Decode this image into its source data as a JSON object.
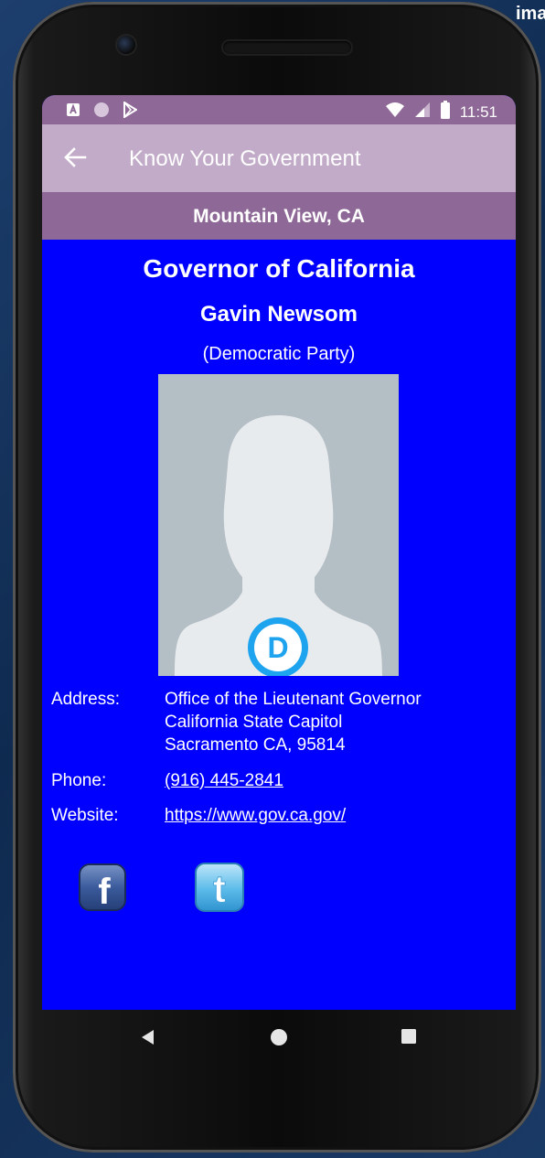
{
  "background_corner_text": "ima",
  "status_bar": {
    "time": "11:51",
    "left_icons": [
      "a-notification-icon",
      "circle-notification-icon",
      "play-store-icon"
    ],
    "right_icons": [
      "wifi-icon",
      "signal-icon",
      "battery-icon"
    ]
  },
  "app_bar": {
    "back_icon": "arrow-back-icon",
    "title": "Know Your Government"
  },
  "location": "Mountain View, CA",
  "official": {
    "office": "Governor of California",
    "name": "Gavin Newsom",
    "party": "(Democratic Party)",
    "party_logo_letter": "D",
    "address_label": "Address:",
    "address_lines": [
      "Office of the Lieutenant Governor",
      "California State Capitol",
      "Sacramento CA, 95814"
    ],
    "phone_label": "Phone:",
    "phone": "(916) 445-2841",
    "website_label": "Website:",
    "website": "https://www.gov.ca.gov/"
  },
  "social": {
    "facebook_letter": "f",
    "twitter_letter": "t"
  },
  "colors": {
    "status_bar": "#8e6896",
    "app_bar": "#c2abc8",
    "location_bar": "#8e6896",
    "democratic_blue": "#0000ff",
    "party_logo": "#1ea3ee"
  },
  "nav_bar": {
    "icons": [
      "back-triangle-icon",
      "home-circle-icon",
      "recents-square-icon"
    ]
  }
}
